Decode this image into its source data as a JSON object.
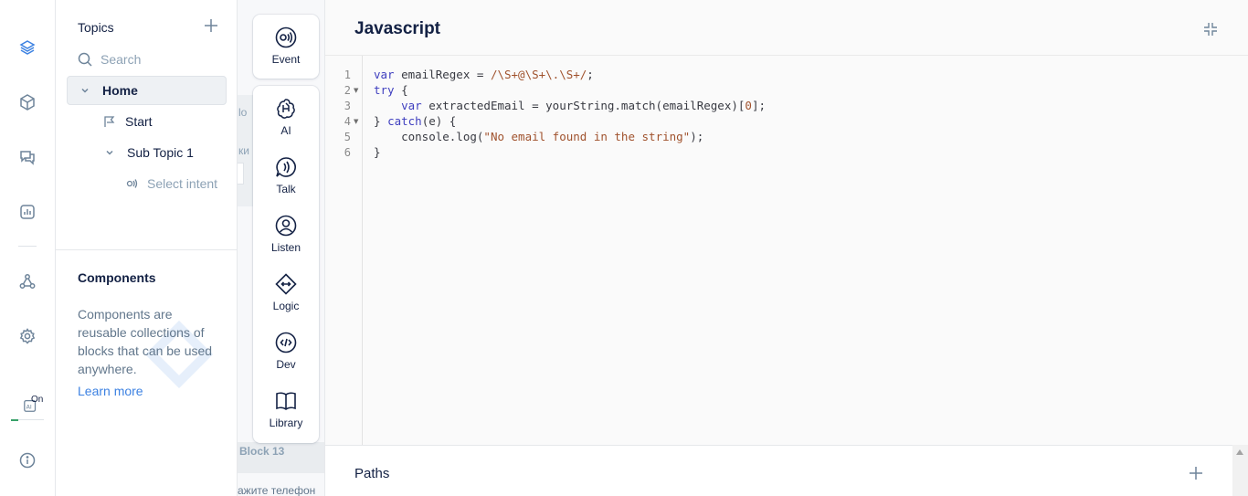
{
  "rail": {
    "ai_badge": "On"
  },
  "topics": {
    "title": "Topics",
    "search_placeholder": "Search",
    "items": [
      {
        "label": "Home"
      },
      {
        "label": "Start"
      },
      {
        "label": "Sub Topic 1"
      },
      {
        "label": "Select intent"
      }
    ]
  },
  "components": {
    "title": "Components",
    "description": "Components are reusable collections of blocks that can be used anywhere.",
    "link": "Learn more"
  },
  "canvas": {
    "fragments": [
      "lo",
      "ки"
    ],
    "block_label": "Block 13",
    "phone_text": "ажите телефон"
  },
  "toolbar": {
    "event": "Event",
    "ai": "AI",
    "talk": "Talk",
    "listen": "Listen",
    "logic": "Logic",
    "dev": "Dev",
    "library": "Library"
  },
  "editor": {
    "title": "Javascript",
    "line_numbers": [
      "1",
      "2",
      "3",
      "4",
      "5",
      "6"
    ],
    "lines": [
      "var emailRegex = /\\S+@\\S+\\.\\S+/;",
      "try {",
      "    var extractedEmail = yourString.match(emailRegex)[0];",
      "} catch(e) {",
      "    console.log(\"No email found in the string\");",
      "}"
    ]
  },
  "paths": {
    "title": "Paths"
  },
  "colors": {
    "accent": "#3d82e2",
    "text": "#132144",
    "muted": "#6e849a"
  }
}
